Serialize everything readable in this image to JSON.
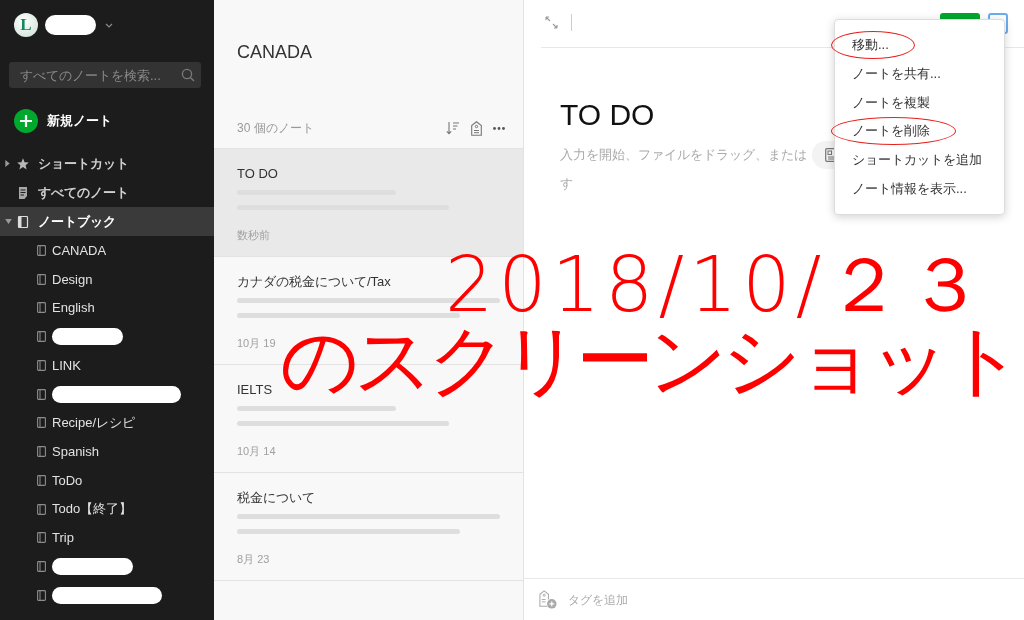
{
  "sidebar": {
    "account": {
      "initial": "L",
      "name_redacted": true
    },
    "search": {
      "placeholder": "すべてのノートを検索..."
    },
    "new_note": {
      "label": "新規ノート"
    },
    "nav": [
      {
        "kind": "shortcuts",
        "label": "ショートカット",
        "expanded": false,
        "selected": false
      },
      {
        "kind": "all_notes",
        "label": "すべてのノート",
        "selected": false
      },
      {
        "kind": "notebooks",
        "label": "ノートブック",
        "expanded": true,
        "selected": true,
        "children": [
          {
            "label": "CANADA",
            "redacted": false,
            "selected": false
          },
          {
            "label": "Design",
            "redacted": false,
            "selected": false
          },
          {
            "label": "English",
            "redacted": false,
            "selected": false
          },
          {
            "redacted": true,
            "selected": false
          },
          {
            "label": "LINK",
            "redacted": false,
            "selected": false
          },
          {
            "redacted": true,
            "selected": false
          },
          {
            "label": "Recipe/レシピ",
            "redacted": false,
            "selected": false
          },
          {
            "label": "Spanish",
            "redacted": false,
            "selected": false
          },
          {
            "label": "ToDo",
            "redacted": false,
            "selected": false
          },
          {
            "label": "Todo【終了】",
            "redacted": false,
            "selected": false
          },
          {
            "label": "Trip",
            "redacted": false,
            "selected": false
          },
          {
            "redacted": true,
            "selected": false
          },
          {
            "redacted": true,
            "selected": false
          }
        ]
      }
    ]
  },
  "note_list": {
    "title": "CANADA",
    "count": "30 個のノート",
    "notes": [
      {
        "title": "TO DO",
        "date": "数秒前",
        "selected": true
      },
      {
        "title": "カナダの税金について/Tax",
        "date": "10月 19",
        "selected": false
      },
      {
        "title": "IELTS",
        "date": "10月 14",
        "selected": false
      },
      {
        "title": "税金について",
        "date": "8月 23",
        "selected": false
      }
    ]
  },
  "editor": {
    "title": "TO DO",
    "hint_start": "入力を開始、ファイルをドラッグ、または",
    "hint_end": "す",
    "tag_placeholder": "タグを追加",
    "menu": {
      "open": true,
      "items": [
        {
          "label": "移動...",
          "circled": true
        },
        {
          "label": "ノートを共有...",
          "circled": false
        },
        {
          "label": "ノートを複製",
          "circled": false
        },
        {
          "label": "ノートを削除",
          "circled": true
        },
        {
          "label": "ショートカットを追加",
          "circled": false
        },
        {
          "label": "ノート情報を表示...",
          "circled": false
        }
      ]
    }
  },
  "annotation": {
    "lines": [
      "2018/10/２３",
      "のスクリーンショット"
    ]
  }
}
